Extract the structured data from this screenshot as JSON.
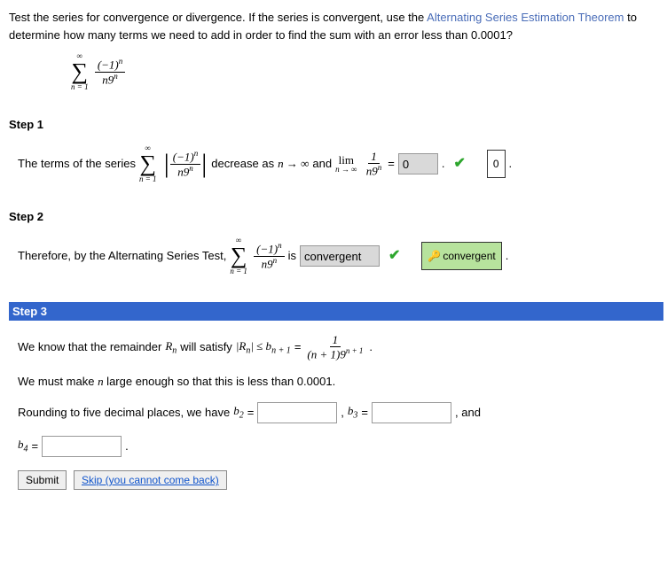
{
  "question": {
    "part1": "Test the series for convergence or divergence. If the series is convergent, use the ",
    "link": "Alternating Series Estimation Theorem",
    "part2": " to determine how many terms we need to add in order to find the sum with an error less than 0.0001?"
  },
  "mainSeries": {
    "top": "∞",
    "num": "(−1)",
    "numExp": "n",
    "den": "n9",
    "denExp": "n",
    "bot": "n = 1"
  },
  "step1": {
    "header": "Step 1",
    "text1": "The terms of the series ",
    "text2": " decrease as ",
    "arrow": "n → ∞",
    "text3": " and ",
    "limTop": "lim",
    "limSub": "n → ∞",
    "limFracNum": "1",
    "limFracDen": "n9",
    "limFracDenExp": "n",
    "eq": " = ",
    "answer": "0",
    "hint": "0"
  },
  "step2": {
    "header": "Step 2",
    "text1": "Therefore, by the Alternating Series Test, ",
    "text2": " is ",
    "answer": "convergent",
    "hint": "convergent",
    "period": "."
  },
  "step3": {
    "header": "Step 3",
    "line1a": "We know that the remainder ",
    "Rn": "R",
    "RnSub": "n",
    "line1b": " will satisfy ",
    "ineq": "|R",
    "ineqSub": "n",
    "ineq2": "| ≤ b",
    "ineqSub2": "n + 1",
    "eq": " = ",
    "fracNum": "1",
    "fracDen1": "(n + 1)9",
    "fracDenExp": "n + 1",
    "period1": ".",
    "line2": "We must make n large enough so that this is less than 0.0001.",
    "line3a": "Rounding to five decimal places, we have ",
    "b2": "b",
    "b2sub": "2",
    "eq2": " = ",
    "comma": " , ",
    "b3": "b",
    "b3sub": "3",
    "eq3": " = ",
    "and": " , and",
    "b4": "b",
    "b4sub": "4",
    "eq4": " = ",
    "period2": "."
  },
  "buttons": {
    "submit": "Submit",
    "skip": "Skip (you cannot come back)"
  }
}
